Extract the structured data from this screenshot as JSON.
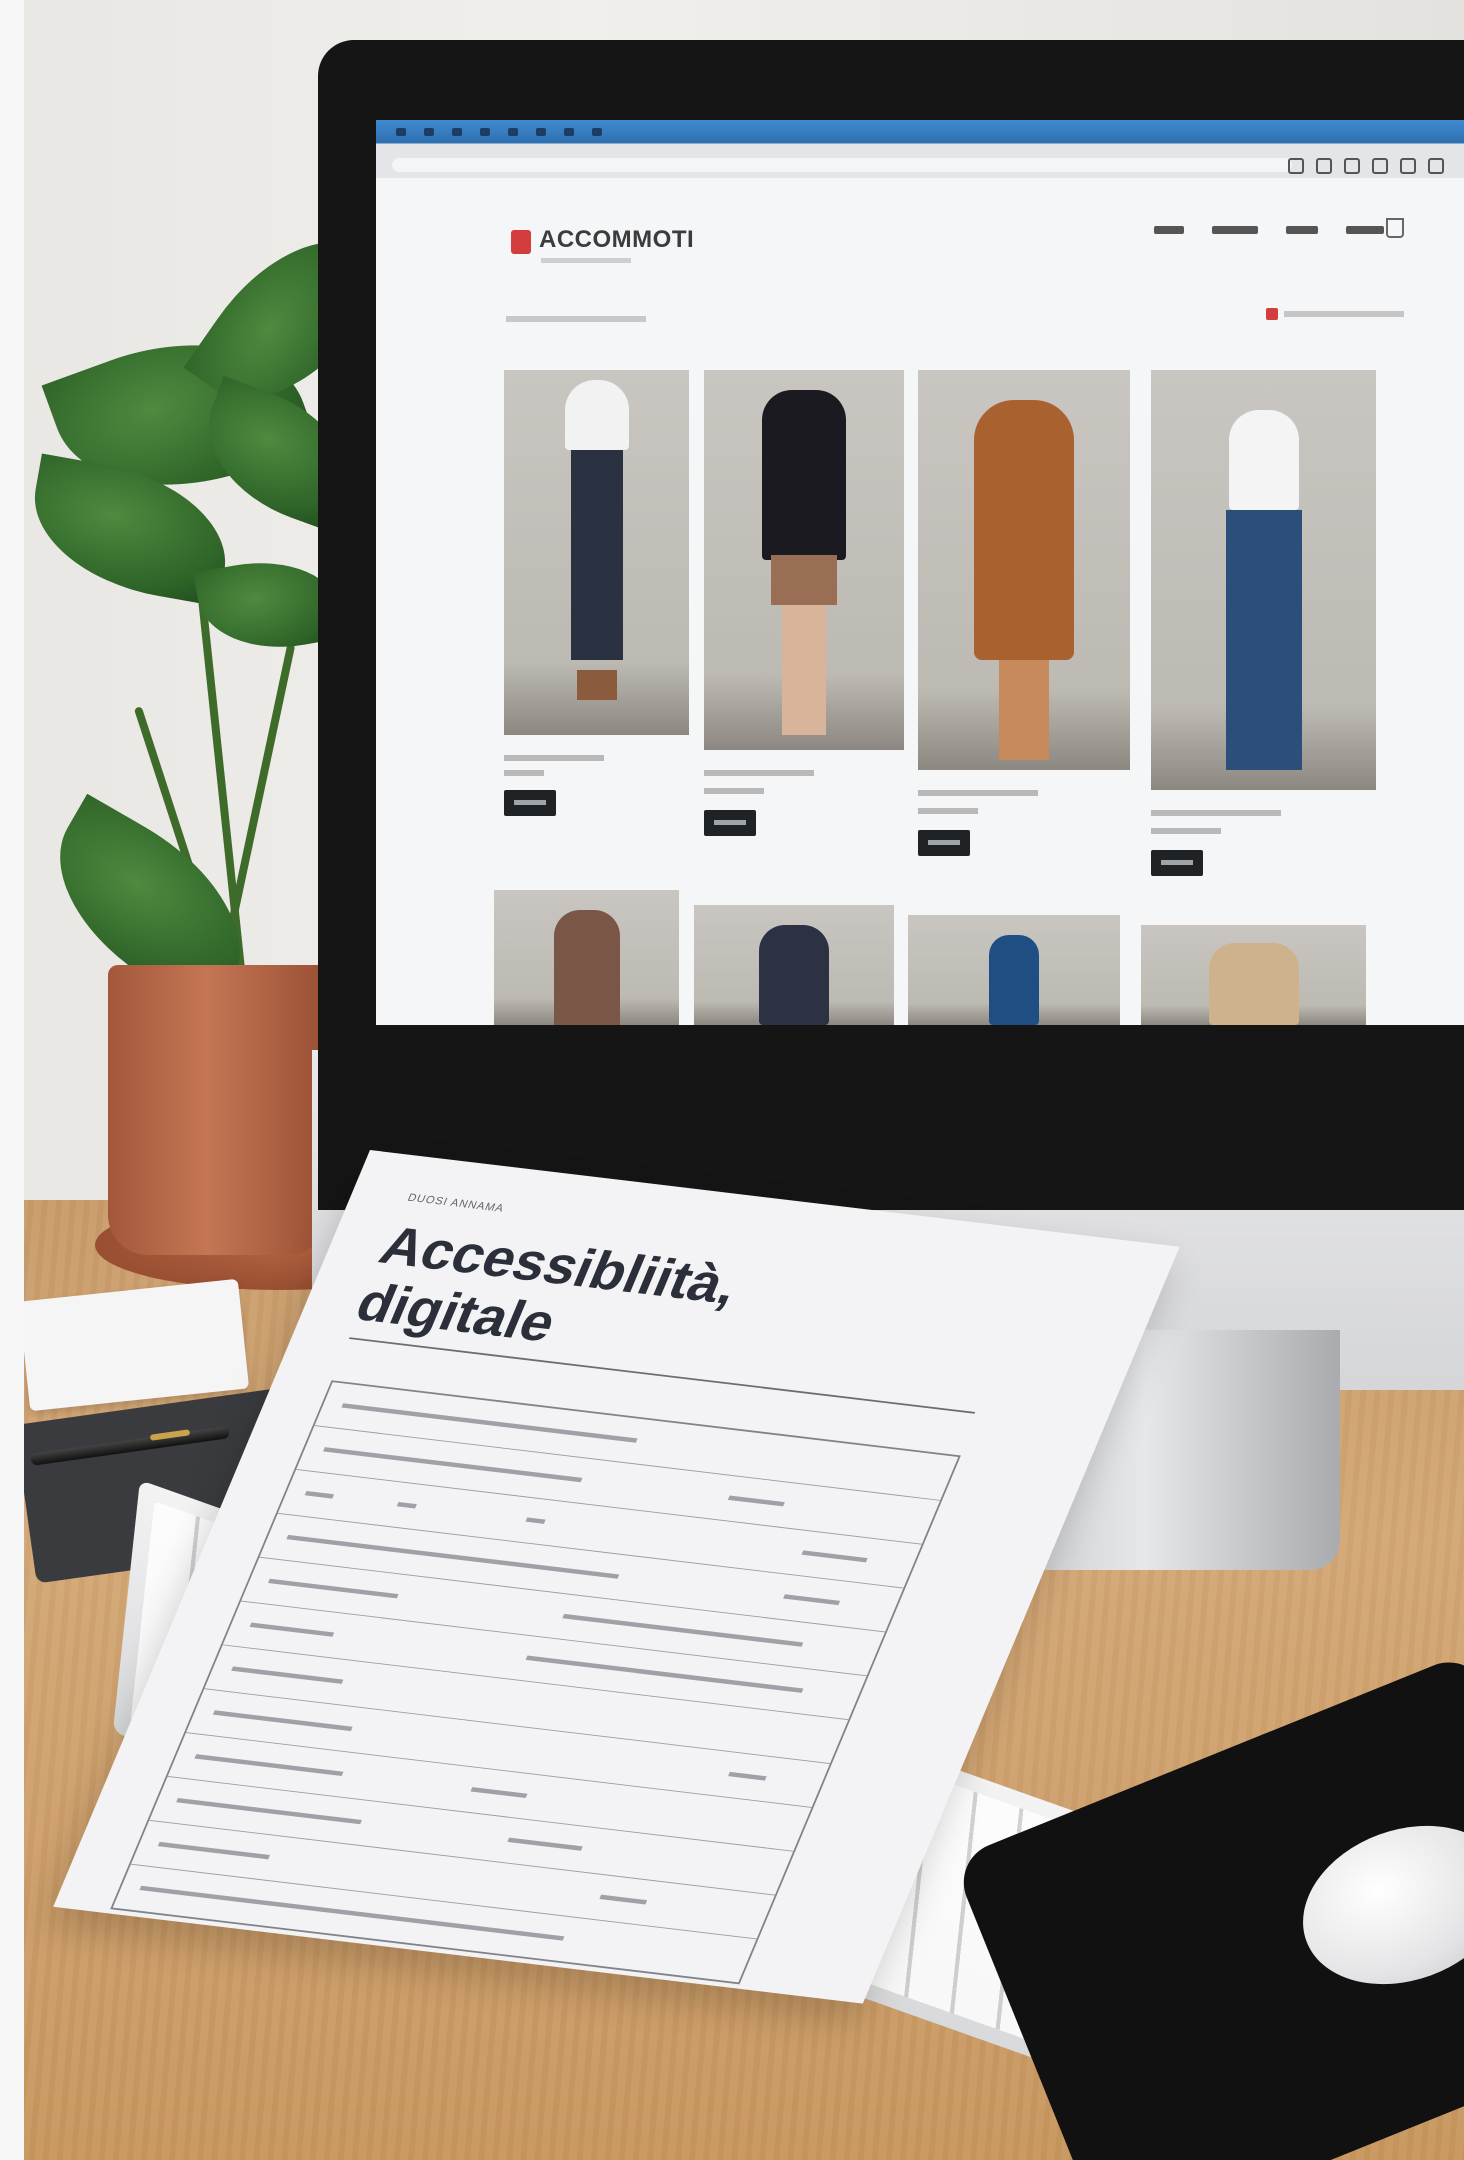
{
  "website": {
    "logo_text": "ACCOMMOTI",
    "nav_items": [
      "",
      "",
      "",
      ""
    ],
    "products": [
      {
        "outfit": "white blouse and dark jeans"
      },
      {
        "outfit": "black jacket and tan shorts"
      },
      {
        "outfit": "rust-brown dress"
      },
      {
        "outfit": "white tank and blue jeans"
      },
      {
        "outfit": "brown coat"
      },
      {
        "outfit": "navy jacket"
      },
      {
        "outfit": "blue top"
      },
      {
        "outfit": "beige jacket"
      }
    ]
  },
  "document": {
    "small_label": "DUOSI ANNAMA",
    "title_line1": "Accessibliità,",
    "title_line2": "digitale"
  },
  "colors": {
    "desk": "#d4a877",
    "pot": "#c47654",
    "logo_accent": "#d33d3d"
  }
}
